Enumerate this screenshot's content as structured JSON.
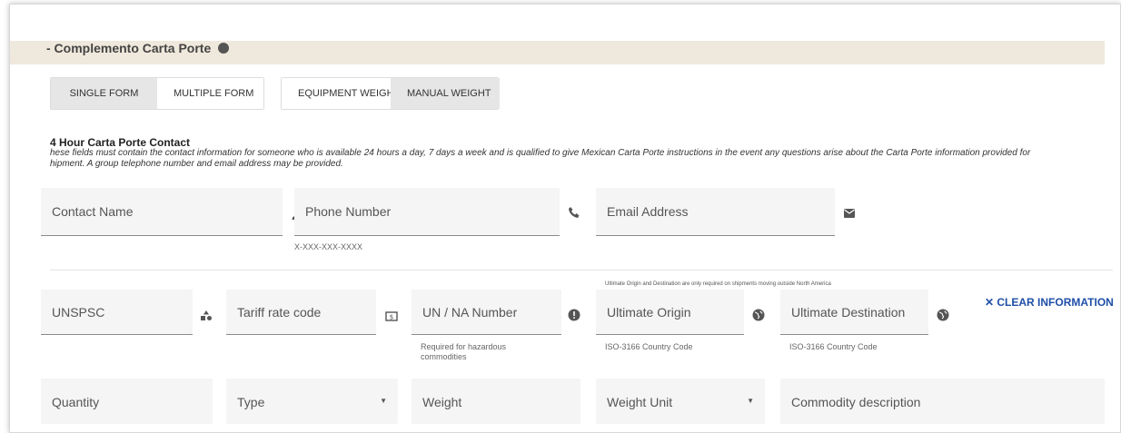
{
  "section": {
    "title": "- Complemento Carta Porte"
  },
  "form_mode": {
    "single": "SINGLE FORM",
    "multiple": "MULTIPLE FORM"
  },
  "weight_mode": {
    "equipment": "EQUIPMENT WEIGHT",
    "manual": "MANUAL WEIGHT"
  },
  "contact": {
    "title": "4 Hour Carta Porte Contact",
    "description_line1": "hese fields must contain the contact information for someone who is available 24 hours a day, 7 days a week and is qualified to give Mexican Carta Porte instructions in the event any questions arise about the Carta Porte information provided for",
    "description_line2": "hipment. A group telephone number and email address may be provided.",
    "name_label": "Contact Name",
    "phone_label": "Phone Number",
    "phone_hint": "X-XXX-XXX-XXXX",
    "email_label": "Email Address"
  },
  "commodity": {
    "notice": "Ultimate Origin and Destination are only required on shipments moving outside North America",
    "unspsc_label": "UNSPSC",
    "tariff_label": "Tariff rate code",
    "un_label": "UN / NA Number",
    "un_hint": "Required for hazardous commodities",
    "origin_label": "Ultimate Origin",
    "origin_hint": "ISO-3166 Country Code",
    "destination_label": "Ultimate Destination",
    "destination_hint": "ISO-3166 Country Code",
    "clear_label": "✕  CLEAR INFORMATION",
    "quantity_label": "Quantity",
    "type_label": "Type",
    "weight_label": "Weight",
    "weight_unit_label": "Weight Unit",
    "description_label": "Commodity description"
  },
  "colors": {
    "header_bg": "#efe8dc",
    "accent": "#1f4fa8"
  }
}
